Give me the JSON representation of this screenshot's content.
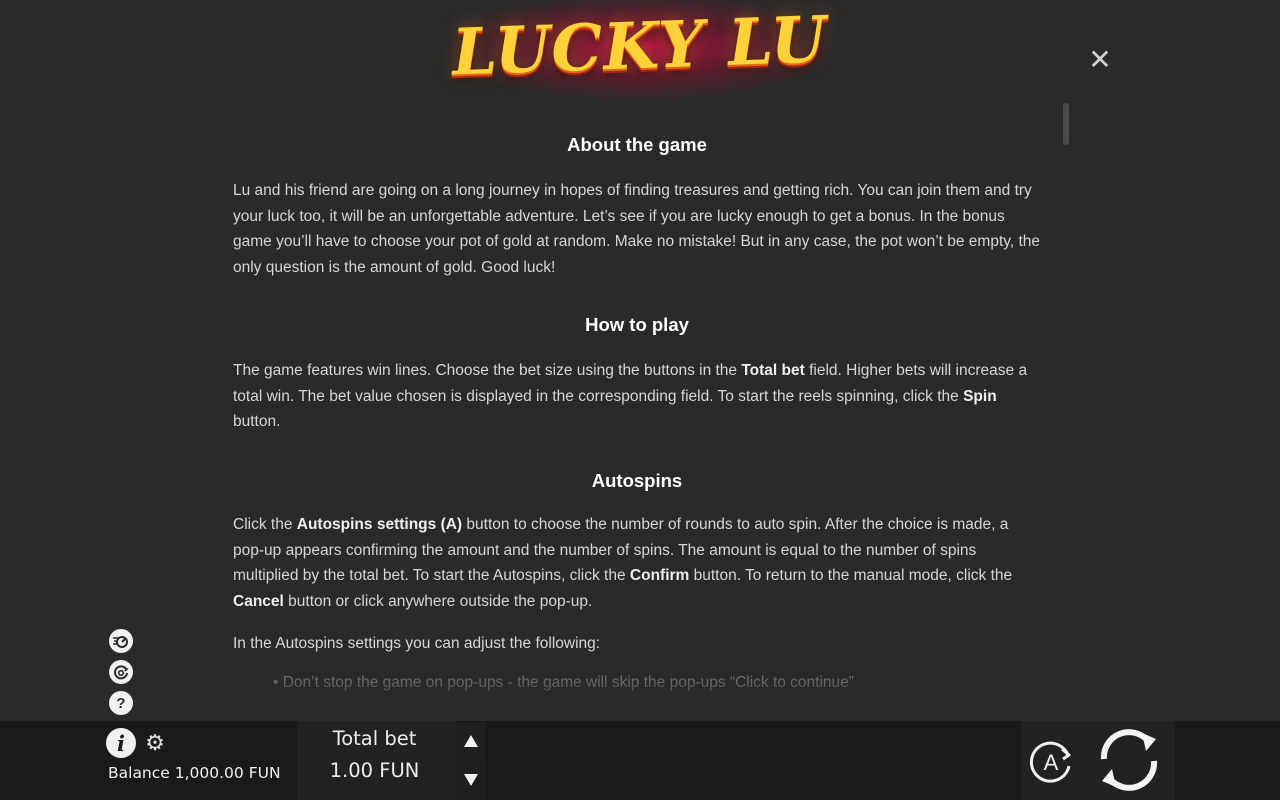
{
  "header": {
    "logo_text": "LUCKY LU",
    "close_icon": "close-icon"
  },
  "sections": {
    "about": {
      "title": "About the game",
      "text": "Lu and his friend are going on a long journey in hopes of finding treasures and getting rich. You can join them and try your luck too, it will be an unforgettable adventure. Let’s see if you are lucky enough to get a bonus. In the bonus game you’ll have to choose your pot of gold at random. Make no mistake! But in any case, the pot won’t be empty, the only question is the amount of gold. Good luck!"
    },
    "howto": {
      "title": "How to play",
      "t1": "The game features win lines. Choose the bet size using the buttons in the ",
      "b1": "Total bet",
      "t2": " field. Higher bets will increase a total win. The bet value chosen is displayed in the corresponding field. To start the reels spinning, click the ",
      "b2": "Spin",
      "t3": " button."
    },
    "autospins": {
      "title": "Autospins",
      "t1": "Click the ",
      "b1": "Autospins settings (A)",
      "t2": " button to choose the number of rounds to auto spin. After the choice is made, a pop-up appears confirming the amount and the number of spins. The amount is equal to the number of spins multiplied by the total bet. To start the Autospins, click the ",
      "b2": "Confirm",
      "t3": " button. To return to the manual mode, click the ",
      "b3": "Cancel",
      "t4": " button or click anywhere outside the pop-up.",
      "adjust_text": "In the Autospins settings you can adjust the following:",
      "list": [
        "Don’t stop the game on pop-ups - the game will skip the pop-ups “Click to continue”"
      ]
    }
  },
  "side_icons": [
    "turbo-icon",
    "autoplay-history-icon",
    "help-icon"
  ],
  "help_glyph": "?",
  "footer": {
    "info_glyph": "i",
    "balance_label": "Balance 1,000.00 FUN",
    "total_bet_label": "Total bet",
    "total_bet_value": "1.00 FUN",
    "auto_label": "A"
  }
}
